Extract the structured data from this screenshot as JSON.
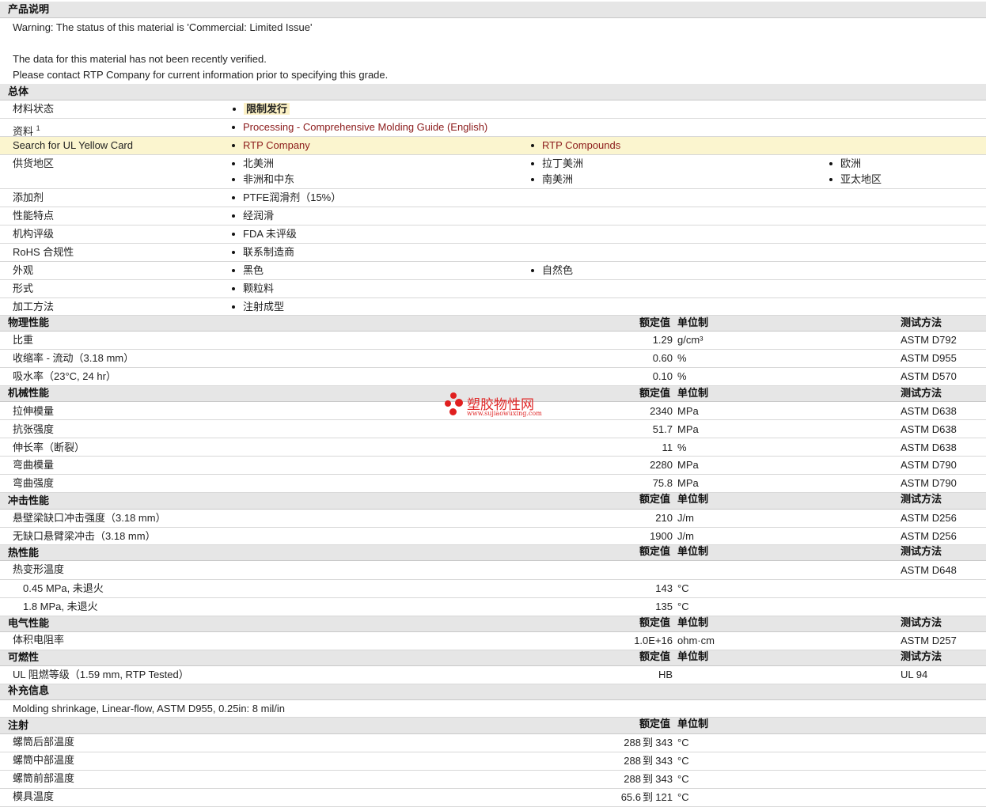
{
  "desc": {
    "title": "产品说明",
    "warning": "Warning: The status of this material is 'Commercial: Limited Issue'",
    "line2": "The data for this material has not been recently verified.",
    "line3": "Please contact RTP Company for current information prior to specifying this grade."
  },
  "general": {
    "title": "总体",
    "status_label": "材料状态",
    "status_value": "限制发行",
    "docs_label": "资料",
    "docs_sup": "1",
    "docs_link": "Processing - Comprehensive Molding Guide (English)",
    "ul_label": "Search for UL Yellow Card",
    "ul_link1": "RTP Company",
    "ul_link2": "RTP Compounds",
    "region_label": "供货地区",
    "regions": [
      "北美洲",
      "拉丁美洲",
      "欧洲",
      "非洲和中东",
      "南美洲",
      "亚太地区"
    ],
    "additive_label": "添加剂",
    "additive_value": "PTFE润滑剂（15%）",
    "feature_label": "性能特点",
    "feature_value": "经润滑",
    "agency_label": "机构评级",
    "agency_value": "FDA 未评级",
    "rohs_label": "RoHS 合规性",
    "rohs_value": "联系制造商",
    "appearance_label": "外观",
    "appearance_values": [
      "黑色",
      "自然色"
    ],
    "form_label": "形式",
    "form_value": "颗粒料",
    "process_label": "加工方法",
    "process_value": "注射成型"
  },
  "headers": {
    "nominal": "额定值",
    "unit": "单位制",
    "method": "测试方法"
  },
  "physical": {
    "title": "物理性能",
    "rows": [
      {
        "name": "比重",
        "value": "1.29",
        "unit": "g/cm³",
        "method": "ASTM D792"
      },
      {
        "name": "收缩率 - 流动（3.18 mm）",
        "value": "0.60",
        "unit": "%",
        "method": "ASTM D955"
      },
      {
        "name": "吸水率（23°C, 24 hr）",
        "value": "0.10",
        "unit": "%",
        "method": "ASTM D570"
      }
    ]
  },
  "mechanical": {
    "title": "机械性能",
    "rows": [
      {
        "name": "拉伸模量",
        "value": "2340",
        "unit": "MPa",
        "method": "ASTM D638"
      },
      {
        "name": "抗张强度",
        "value": "51.7",
        "unit": "MPa",
        "method": "ASTM D638"
      },
      {
        "name": "伸长率（断裂）",
        "value": "11",
        "unit": "%",
        "method": "ASTM D638"
      },
      {
        "name": "弯曲模量",
        "value": "2280",
        "unit": "MPa",
        "method": "ASTM D790"
      },
      {
        "name": "弯曲强度",
        "value": "75.8",
        "unit": "MPa",
        "method": "ASTM D790"
      }
    ]
  },
  "impact": {
    "title": "冲击性能",
    "rows": [
      {
        "name": "悬壁梁缺口冲击强度（3.18 mm）",
        "value": "210",
        "unit": "J/m",
        "method": "ASTM D256"
      },
      {
        "name": "无缺口悬臂梁冲击（3.18 mm）",
        "value": "1900",
        "unit": "J/m",
        "method": "ASTM D256"
      }
    ]
  },
  "thermal": {
    "title": "热性能",
    "rows": [
      {
        "name": "热变形温度",
        "value": "",
        "unit": "",
        "method": "ASTM D648"
      },
      {
        "name": "0.45 MPa, 未退火",
        "value": "143",
        "unit": "°C",
        "method": ""
      },
      {
        "name": "1.8 MPa, 未退火",
        "value": "135",
        "unit": "°C",
        "method": ""
      }
    ]
  },
  "electrical": {
    "title": "电气性能",
    "rows": [
      {
        "name": "体积电阻率",
        "value": "1.0E+16",
        "unit": "ohm·cm",
        "method": "ASTM D257"
      }
    ]
  },
  "flammability": {
    "title": "可燃性",
    "rows": [
      {
        "name": "UL 阻燃等级（1.59 mm, RTP Tested）",
        "value": "HB",
        "unit": "",
        "method": "UL 94"
      }
    ]
  },
  "supplement": {
    "title": "补充信息",
    "text": "Molding shrinkage, Linear-flow, ASTM D955, 0.25in: 8 mil/in"
  },
  "injection": {
    "title": "注射",
    "to": "到",
    "rows": [
      {
        "name": "螺筒后部温度",
        "from": "288",
        "to_value": "343",
        "unit": "°C"
      },
      {
        "name": "螺筒中部温度",
        "from": "288",
        "to_value": "343",
        "unit": "°C"
      },
      {
        "name": "螺筒前部温度",
        "from": "288",
        "to_value": "343",
        "unit": "°C"
      },
      {
        "name": "模具温度",
        "from": "65.6",
        "to_value": "121",
        "unit": "°C"
      }
    ]
  },
  "watermark": {
    "cn": "塑胶物性网",
    "url": "www.sujiaowuxing.com"
  }
}
